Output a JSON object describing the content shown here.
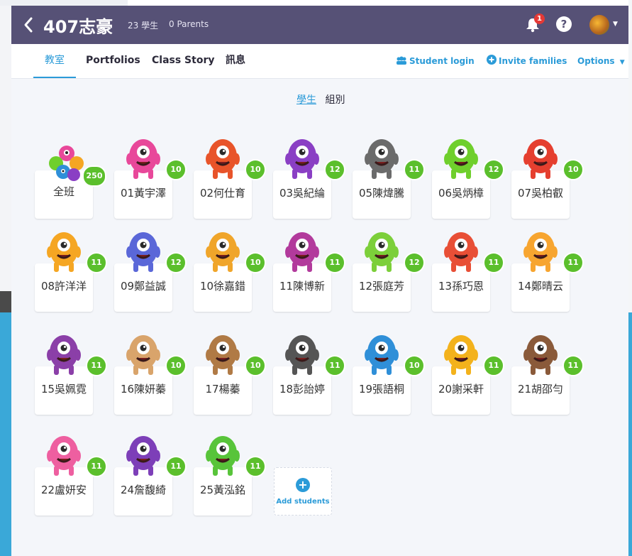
{
  "header": {
    "class_name": "407志豪",
    "students_count": "23 學生",
    "parents_count": "0 Parents",
    "notifications": "1"
  },
  "tabs": [
    "教室",
    "Portfolios",
    "Class Story",
    "訊息"
  ],
  "actions": {
    "student_login": "Student login",
    "invite_families": "Invite families",
    "options": "Options"
  },
  "view_toggle": {
    "students": "學生",
    "groups": "組別"
  },
  "whole_class": {
    "label": "全班",
    "points": "250"
  },
  "students": [
    {
      "name": "01黃宇澤",
      "points": "10",
      "color": "#e8489a"
    },
    {
      "name": "02何仕育",
      "points": "10",
      "color": "#e8542a"
    },
    {
      "name": "03吳紀綸",
      "points": "12",
      "color": "#8a3fc4"
    },
    {
      "name": "05陳煒騰",
      "points": "11",
      "color": "#6b6b6b"
    },
    {
      "name": "06吳炳樟",
      "points": "12",
      "color": "#6fcf2c"
    },
    {
      "name": "07吳柏叡",
      "points": "10",
      "color": "#e53f2f"
    },
    {
      "name": "08許洋洋",
      "points": "11",
      "color": "#f5a623"
    },
    {
      "name": "09鄭益誠",
      "points": "12",
      "color": "#5a67d8"
    },
    {
      "name": "10徐嘉錯",
      "points": "10",
      "color": "#f0a52a"
    },
    {
      "name": "11陳博新",
      "points": "11",
      "color": "#b23a9c"
    },
    {
      "name": "12張庭芳",
      "points": "12",
      "color": "#7ccf3a"
    },
    {
      "name": "13孫巧恩",
      "points": "11",
      "color": "#e84f36"
    },
    {
      "name": "14鄭晴云",
      "points": "11",
      "color": "#f7a530"
    },
    {
      "name": "15吳姵霓",
      "points": "11",
      "color": "#8b3fa8"
    },
    {
      "name": "16陳妍蓁",
      "points": "10",
      "color": "#d9a46b"
    },
    {
      "name": "17楊蓁",
      "points": "10",
      "color": "#b07a45"
    },
    {
      "name": "18彭詒婷",
      "points": "11",
      "color": "#555555"
    },
    {
      "name": "19張語桐",
      "points": "10",
      "color": "#2f8fd8"
    },
    {
      "name": "20謝采軒",
      "points": "11",
      "color": "#f3b21c"
    },
    {
      "name": "21胡邵勻",
      "points": "11",
      "color": "#8a5a3a"
    },
    {
      "name": "22盧妍安",
      "points": "11",
      "color": "#ee5fa0"
    },
    {
      "name": "24詹馥綺",
      "points": "11",
      "color": "#7d3fb8"
    },
    {
      "name": "25黃泓銘",
      "points": "11",
      "color": "#58c43a"
    }
  ],
  "add_students": "Add students"
}
